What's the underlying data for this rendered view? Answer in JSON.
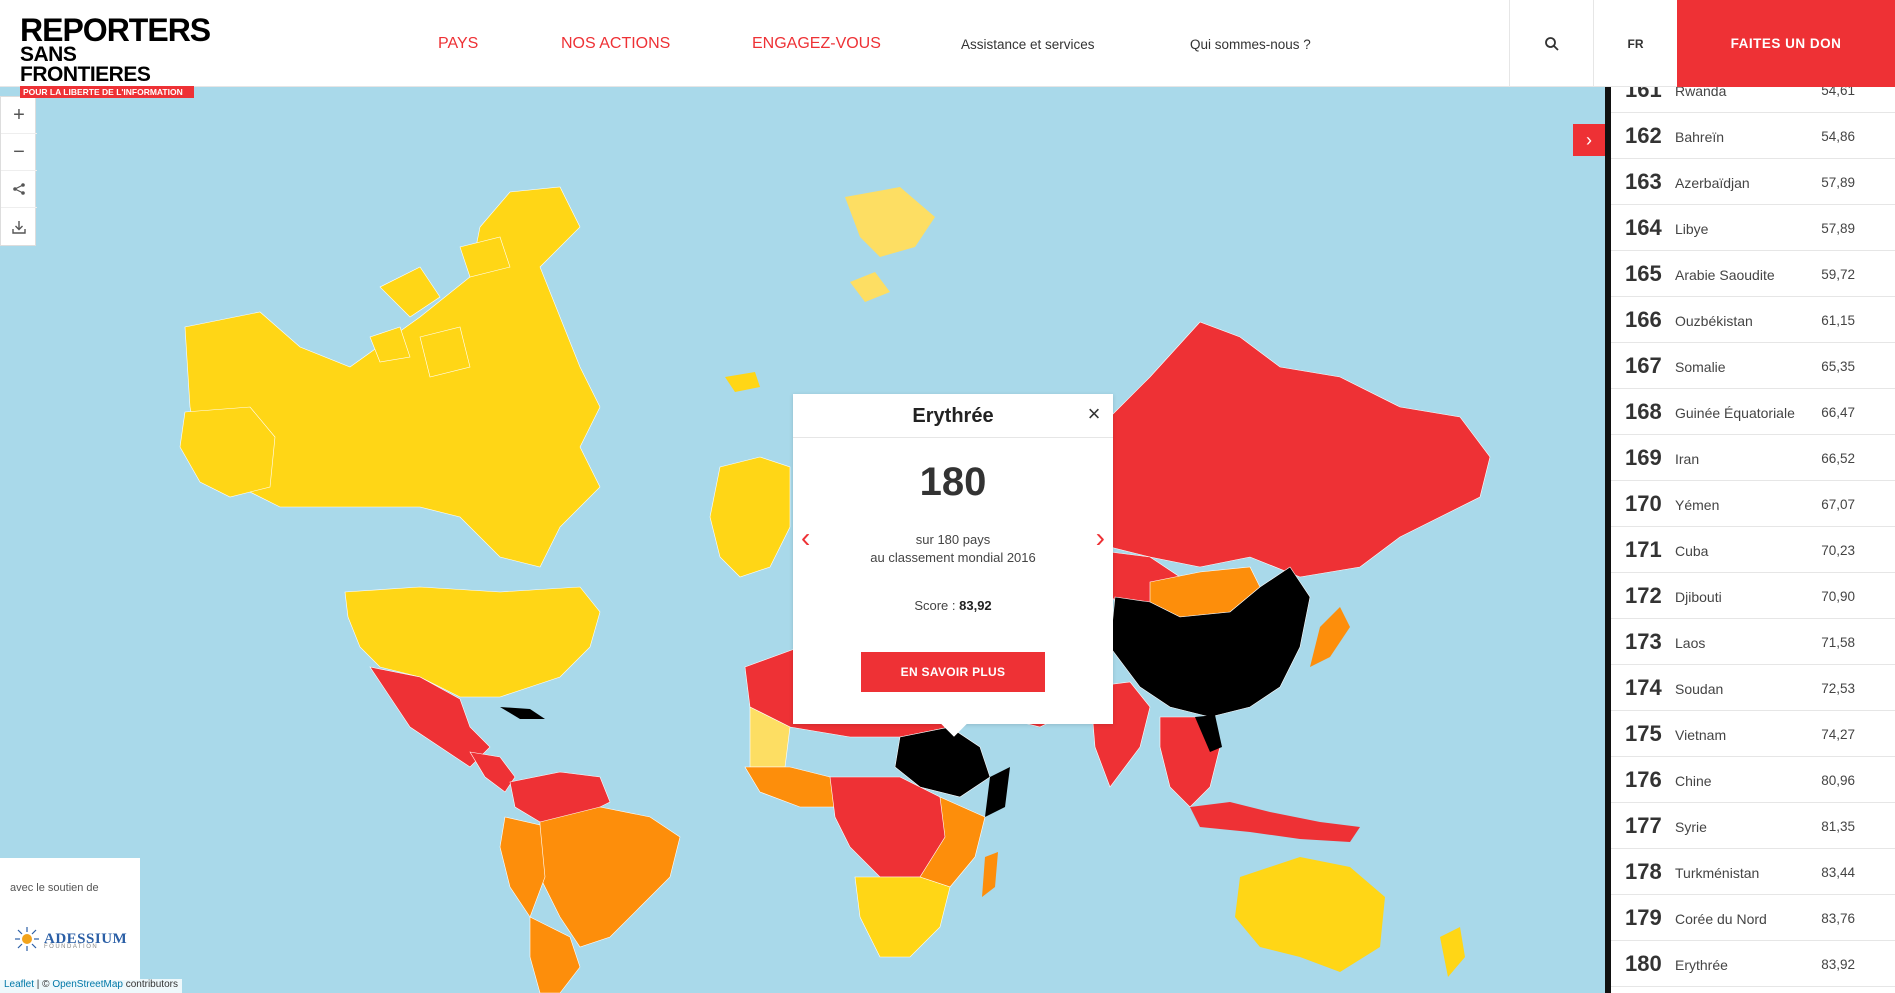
{
  "logo": {
    "line1": "REPORTERS",
    "line2": "SANS FRONTIERES",
    "line3": "POUR LA LIBERTE DE L'INFORMATION"
  },
  "nav": {
    "items": [
      "PAYS",
      "NOS ACTIONS",
      "ENGAGEZ-VOUS",
      "Assistance et services",
      "Qui sommes-nous ?"
    ],
    "lang": "FR",
    "donate": "FAITES UN DON"
  },
  "colors": {
    "accent": "#ee3135",
    "good": "#ffd616",
    "satisfactory": "#fdde63",
    "problematic": "#fd8e0b",
    "difficult": "#ee3135",
    "very_serious": "#000000",
    "water": "#a9d9ea"
  },
  "map_controls": {
    "zoom_in": "+",
    "zoom_out": "−",
    "share_icon": "share-icon",
    "download_icon": "download-icon"
  },
  "popup": {
    "country": "Erythrée",
    "rank": "180",
    "line1": "sur 180 pays",
    "line2": "au classement mondial 2016",
    "score_label": "Score : ",
    "score_value": "83,92",
    "button": "EN SAVOIR PLUS"
  },
  "sponsor": {
    "text": "avec le soutien de",
    "brand": "ADESSIUM",
    "brand_sub": "FOUNDATION"
  },
  "attribution": {
    "leaflet": "Leaflet",
    "sep": " | © ",
    "osm": "OpenStreetMap",
    "rest": " contributors"
  },
  "ranking": [
    {
      "rank": "161",
      "country": "Rwanda",
      "score": "54,61"
    },
    {
      "rank": "162",
      "country": "Bahreïn",
      "score": "54,86"
    },
    {
      "rank": "163",
      "country": "Azerbaïdjan",
      "score": "57,89"
    },
    {
      "rank": "164",
      "country": "Libye",
      "score": "57,89"
    },
    {
      "rank": "165",
      "country": "Arabie Saoudite",
      "score": "59,72"
    },
    {
      "rank": "166",
      "country": "Ouzbékistan",
      "score": "61,15"
    },
    {
      "rank": "167",
      "country": "Somalie",
      "score": "65,35"
    },
    {
      "rank": "168",
      "country": "Guinée Équatoriale",
      "score": "66,47"
    },
    {
      "rank": "169",
      "country": "Iran",
      "score": "66,52"
    },
    {
      "rank": "170",
      "country": "Yémen",
      "score": "67,07"
    },
    {
      "rank": "171",
      "country": "Cuba",
      "score": "70,23"
    },
    {
      "rank": "172",
      "country": "Djibouti",
      "score": "70,90"
    },
    {
      "rank": "173",
      "country": "Laos",
      "score": "71,58"
    },
    {
      "rank": "174",
      "country": "Soudan",
      "score": "72,53"
    },
    {
      "rank": "175",
      "country": "Vietnam",
      "score": "74,27"
    },
    {
      "rank": "176",
      "country": "Chine",
      "score": "80,96"
    },
    {
      "rank": "177",
      "country": "Syrie",
      "score": "81,35"
    },
    {
      "rank": "178",
      "country": "Turkménistan",
      "score": "83,44"
    },
    {
      "rank": "179",
      "country": "Corée du Nord",
      "score": "83,76"
    },
    {
      "rank": "180",
      "country": "Erythrée",
      "score": "83,92"
    }
  ]
}
